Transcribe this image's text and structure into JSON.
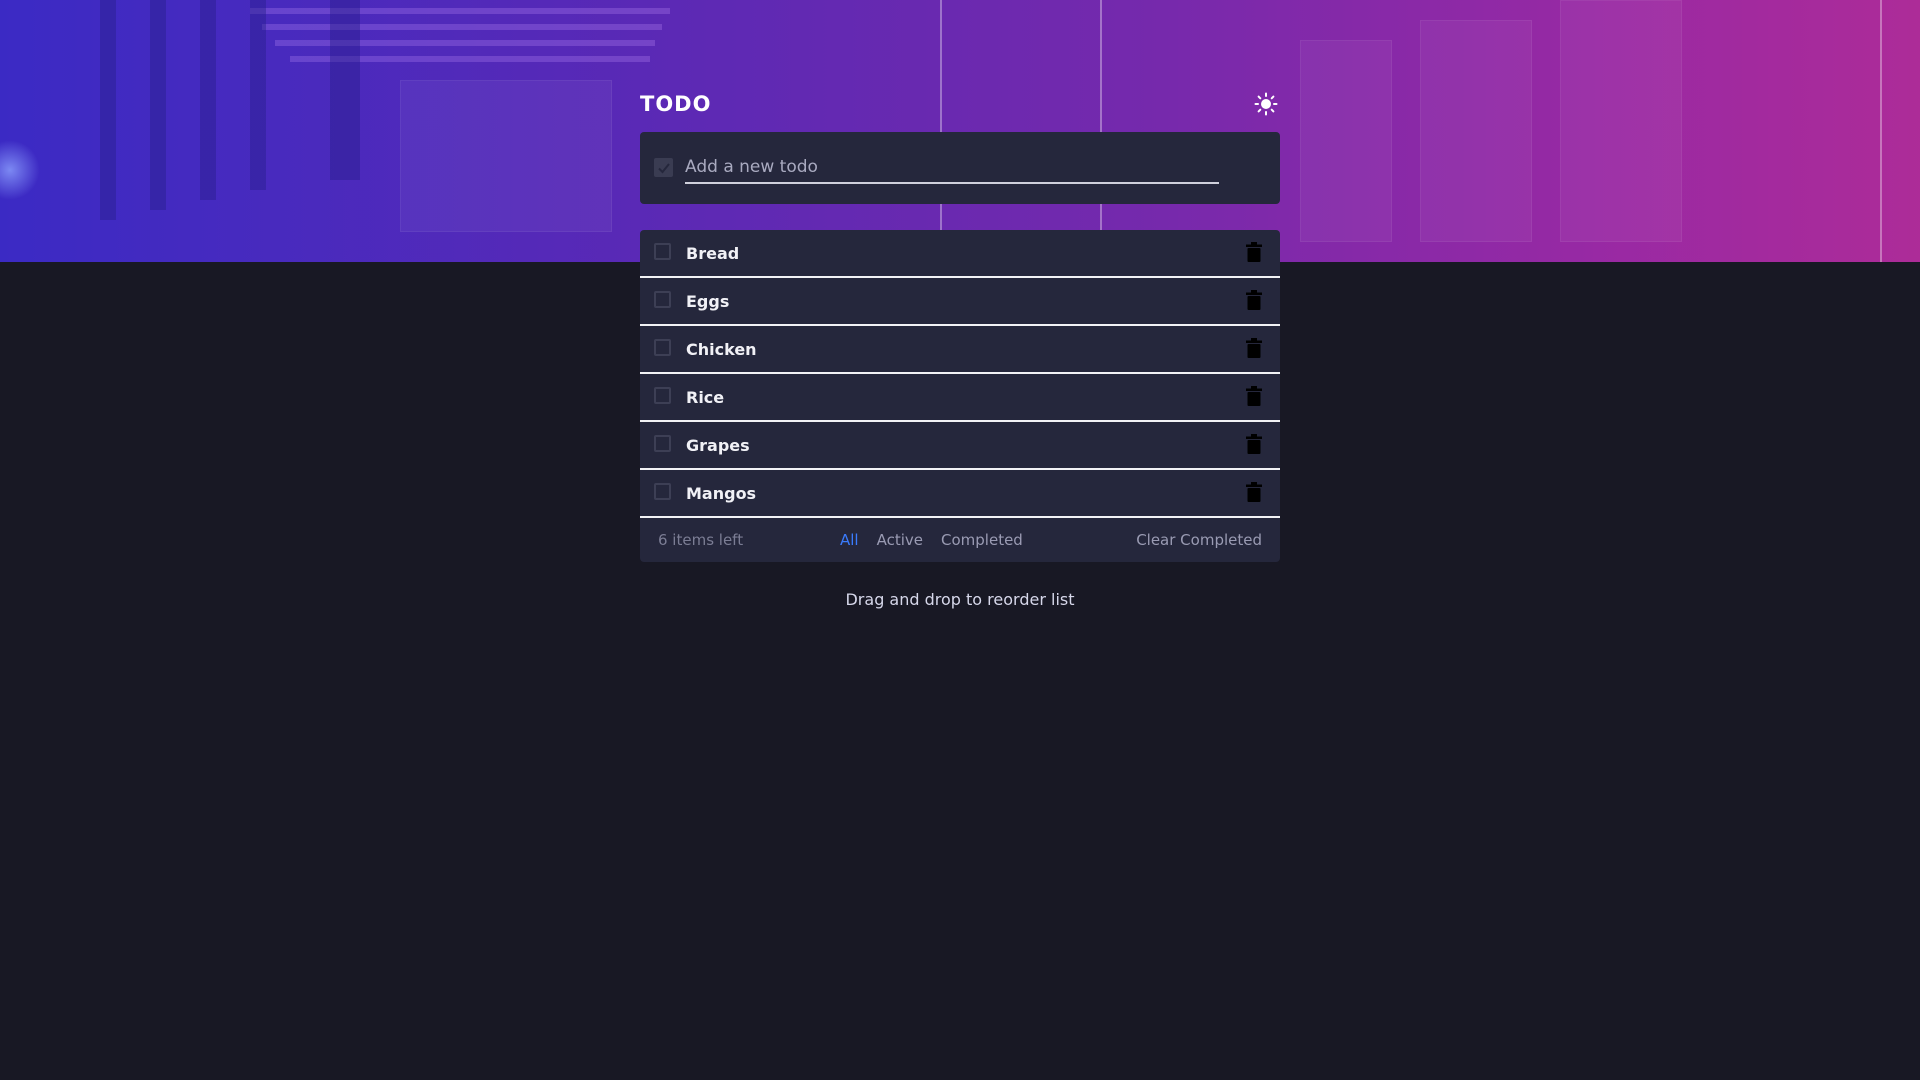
{
  "header": {
    "title": "TODO",
    "theme_icon": "sun-icon"
  },
  "new_todo": {
    "placeholder": "Add a new todo",
    "value": ""
  },
  "todos": [
    {
      "label": "Bread",
      "completed": false
    },
    {
      "label": "Eggs",
      "completed": false
    },
    {
      "label": "Chicken",
      "completed": false
    },
    {
      "label": "Rice",
      "completed": false
    },
    {
      "label": "Grapes",
      "completed": false
    },
    {
      "label": "Mangos",
      "completed": false
    }
  ],
  "footer": {
    "items_left": "6 items left",
    "filters": [
      "All",
      "Active",
      "Completed"
    ],
    "active_filter": "All",
    "clear_label": "Clear Completed"
  },
  "hint": "Drag and drop to reorder list",
  "colors": {
    "background": "#181824",
    "card": "#25273c",
    "accent": "#3a7bfd"
  }
}
